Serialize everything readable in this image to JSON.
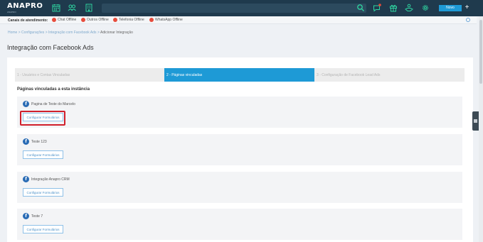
{
  "app": {
    "logo": "ANAPRO",
    "logo_sub": "ANAPRO"
  },
  "topnav": {
    "icons": [
      "calendar-icon",
      "users-icon",
      "building-icon",
      "search-icon",
      "chat-icon",
      "gift-icon",
      "handshake-icon",
      "gear-icon"
    ],
    "notification_badge_color": "#e74c3c",
    "new_button_label": "Novo",
    "plus_label": "+"
  },
  "channels": {
    "label": "Canais de atendimento:",
    "items": [
      {
        "label": "Chat Offline",
        "status_color": "#e74c3c"
      },
      {
        "label": "Outros Offline",
        "status_color": "#e74c3c"
      },
      {
        "label": "Telefonia Offline",
        "status_color": "#e74c3c"
      },
      {
        "label": "WhatsApp Offline",
        "status_color": "#e74c3c"
      }
    ]
  },
  "breadcrumb": {
    "items": [
      "Home",
      "Configurações",
      "Integração com Facebook Ads"
    ],
    "current": "Adicionar Integração"
  },
  "page": {
    "title": "Integração com Facebook Ads"
  },
  "steps": [
    {
      "label": "1 - Usuários e Contas Vinculadas",
      "active": false
    },
    {
      "label": "2 - Páginas vinculadas",
      "active": true
    },
    {
      "label": "3 - Configuração de Facebook Lead Ads",
      "active": false
    }
  ],
  "section": {
    "title": "Páginas vinculadas a esta instância"
  },
  "pages": [
    {
      "name": "Pagina de Teste do Marcelo",
      "button": "Configurar Formulários",
      "highlighted": true
    },
    {
      "name": "Teste 123",
      "button": "Configurar Formulários",
      "highlighted": false
    },
    {
      "name": "Integração Anapro CRM",
      "button": "Configurar Formulários",
      "highlighted": false
    },
    {
      "name": "Teste 7",
      "button": "Configurar Formulários",
      "highlighted": false
    }
  ],
  "colors": {
    "nav_bg": "#1f3a4d",
    "accent": "#1e9ad6",
    "facebook": "#2a6cb5",
    "highlight": "#d0202c"
  }
}
